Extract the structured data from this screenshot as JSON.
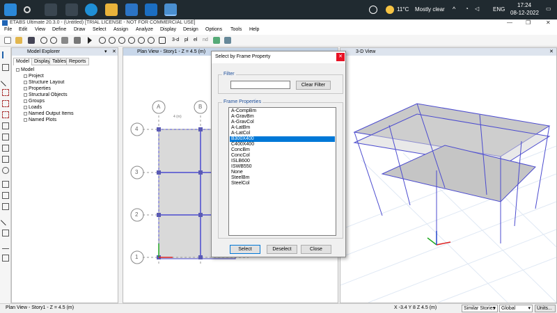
{
  "taskbar": {
    "weather_temp": "11°C",
    "weather_text": "Mostly clear",
    "lang": "ENG",
    "time": "17:24",
    "date": "08-12-2022"
  },
  "window": {
    "title": "ETABS Ultimate 20.3.0 - (Untitled)  [TRIAL LICENSE - NOT FOR COMMERCIAL USE]"
  },
  "menu": [
    "File",
    "Edit",
    "View",
    "Define",
    "Draw",
    "Select",
    "Assign",
    "Analyze",
    "Display",
    "Design",
    "Options",
    "Tools",
    "Help"
  ],
  "toolbar": {
    "view_3d": "3-d",
    "view_pl": "pl",
    "view_el": "el",
    "view_nd": "nd"
  },
  "explorer": {
    "title": "Model Explorer",
    "tabs": [
      "Model",
      "Display",
      "Tables",
      "Reports"
    ],
    "tree_root": "Model",
    "tree_items": [
      "Project",
      "Structure Layout",
      "Properties",
      "Structural Objects",
      "Groups",
      "Loads",
      "Named Output Items",
      "Named Plots"
    ]
  },
  "plan_view": {
    "title": "Plan View - Story1 - Z = 4.5 (m)",
    "grid_cols": [
      "A",
      "B"
    ],
    "grid_rows": [
      "4",
      "3",
      "2",
      "1"
    ],
    "dim_label": "4 (m)"
  },
  "view_3d": {
    "title": "3-D View"
  },
  "dialog": {
    "title": "Select by Frame Property",
    "filter_label": "Filter",
    "filter_value": "",
    "clear_filter": "Clear Filter",
    "props_label": "Frame Properties",
    "items": [
      "A-CompBm",
      "A-GravBm",
      "A-GravCol",
      "A-LatBm",
      "A-LatCol",
      "B300X400",
      "C400X400",
      "ConcBm",
      "ConcCol",
      "ISLB600",
      "ISWB550",
      "None",
      "SteelBm",
      "SteelCol"
    ],
    "selected_index": 5,
    "select_btn": "Select",
    "deselect_btn": "Deselect",
    "close_btn": "Close"
  },
  "status": {
    "view": "Plan View - Story1 - Z = 4.5 (m)",
    "coords": "X -3.4  Y 8  Z 4.5 (m)",
    "story_option": "Similar Stories",
    "coord_sys": "Global",
    "units_btn": "Units..."
  },
  "colors": {
    "taskbar": "#202a30",
    "selection": "#0078d7",
    "frame": "#4b4bcf"
  }
}
